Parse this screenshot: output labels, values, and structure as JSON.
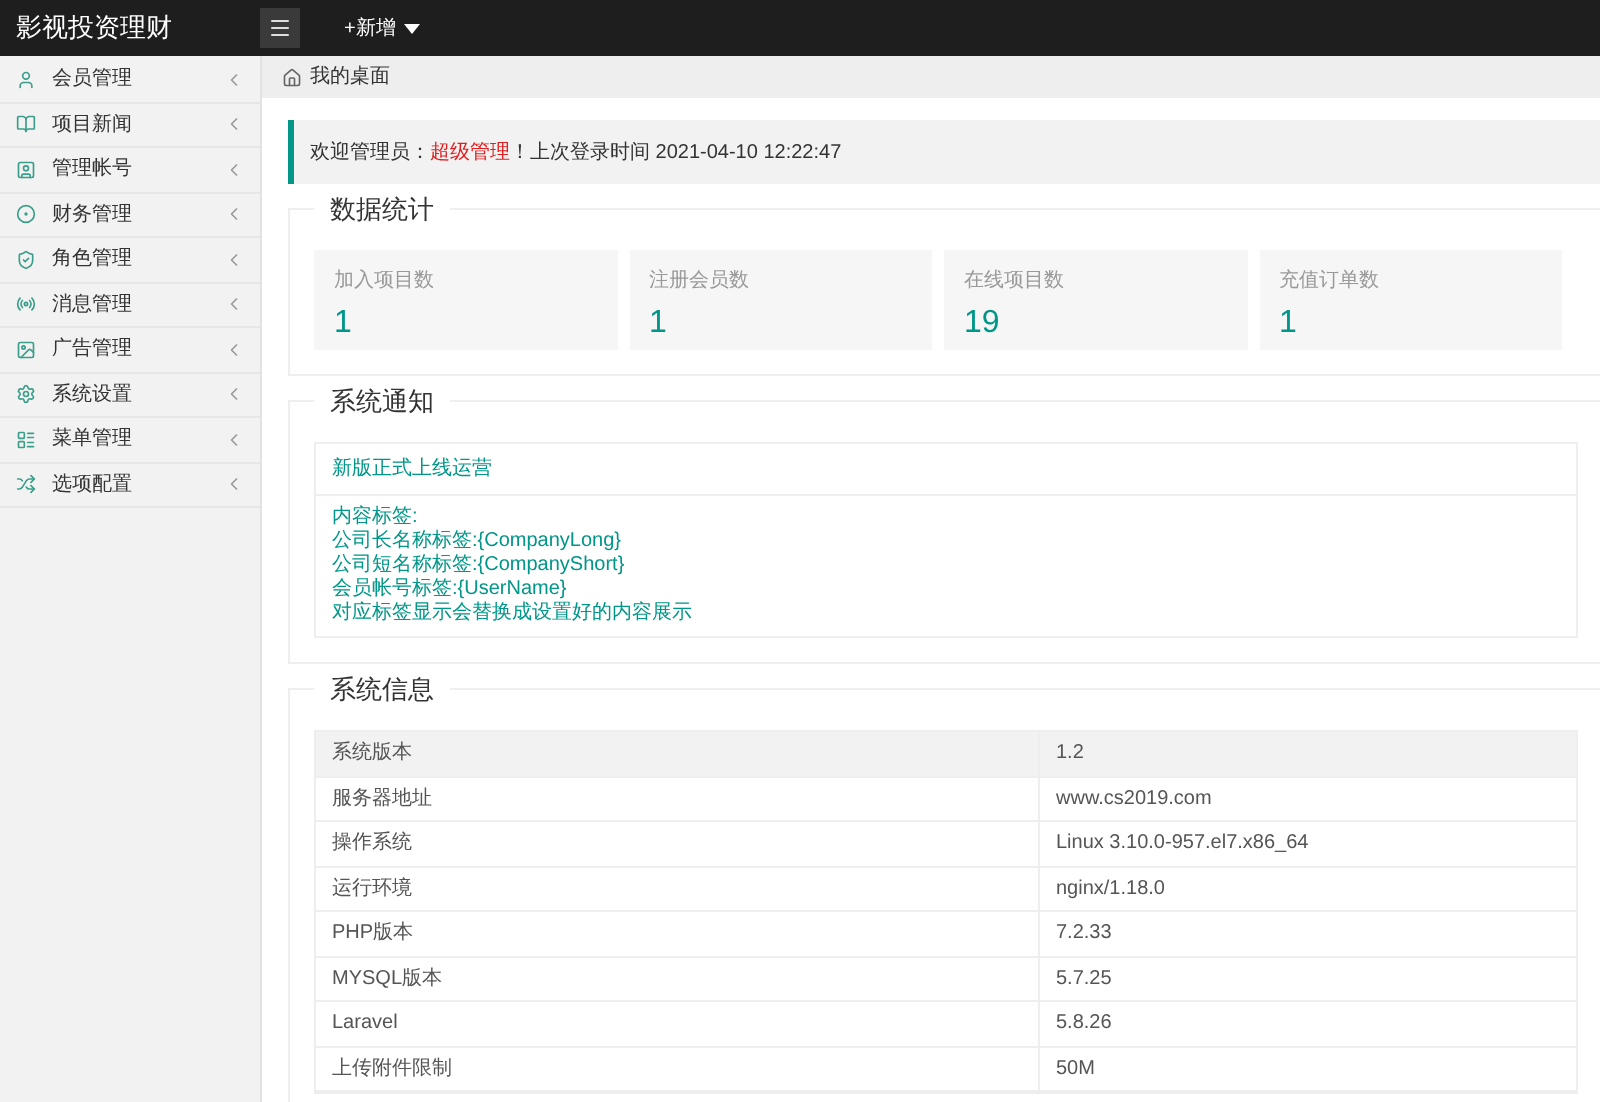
{
  "header": {
    "logo": "影视投资理财",
    "add_menu": "+新增"
  },
  "sidebar": {
    "items": [
      {
        "label": "会员管理"
      },
      {
        "label": "项目新闻"
      },
      {
        "label": "管理帐号"
      },
      {
        "label": "财务管理"
      },
      {
        "label": "角色管理"
      },
      {
        "label": "消息管理"
      },
      {
        "label": "广告管理"
      },
      {
        "label": "系统设置"
      },
      {
        "label": "菜单管理"
      },
      {
        "label": "选项配置"
      }
    ]
  },
  "breadcrumb": "我的桌面",
  "welcome": {
    "prefix": "欢迎管理员：",
    "role": "超级管理",
    "suffix": "！上次登录时间 2021-04-10 12:22:47"
  },
  "stats": {
    "title": "数据统计",
    "cards": [
      {
        "label": "加入项目数",
        "value": "1"
      },
      {
        "label": "注册会员数",
        "value": "1"
      },
      {
        "label": "在线项目数",
        "value": "19"
      },
      {
        "label": "充值订单数",
        "value": "1"
      }
    ]
  },
  "notice": {
    "title": "系统通知",
    "headline": "新版正式上线运营",
    "lines": [
      "内容标签:",
      "公司长名称标签:{CompanyLong}",
      "公司短名称标签:{CompanyShort}",
      "会员帐号标签:{UserName}",
      "对应标签显示会替换成设置好的内容展示"
    ]
  },
  "system_info": {
    "title": "系统信息",
    "rows": [
      {
        "label": "系统版本",
        "value": "1.2"
      },
      {
        "label": "服务器地址",
        "value": "www.cs2019.com"
      },
      {
        "label": "操作系统",
        "value": "Linux 3.10.0-957.el7.x86_64"
      },
      {
        "label": "运行环境",
        "value": "nginx/1.18.0"
      },
      {
        "label": "PHP版本",
        "value": "7.2.33"
      },
      {
        "label": "MYSQL版本",
        "value": "5.7.25"
      },
      {
        "label": "Laravel",
        "value": "5.8.26"
      },
      {
        "label": "上传附件限制",
        "value": "50M"
      }
    ]
  }
}
